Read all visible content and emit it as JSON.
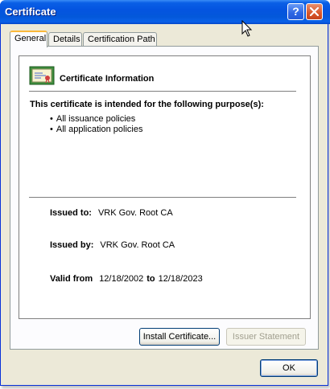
{
  "window": {
    "title": "Certificate",
    "help_label": "?"
  },
  "tabs": [
    {
      "label": "General",
      "active": true
    },
    {
      "label": "Details",
      "active": false
    },
    {
      "label": "Certification Path",
      "active": false
    }
  ],
  "general": {
    "info_title": "Certificate Information",
    "purpose_heading": "This certificate is intended for the following purpose(s):",
    "purposes": [
      "All issuance policies",
      "All application policies"
    ],
    "issued_to_label": "Issued to:",
    "issued_to_value": "VRK Gov. Root CA",
    "issued_by_label": "Issued by:",
    "issued_by_value": "VRK Gov. Root CA",
    "valid_from_label": "Valid from",
    "valid_from_value": "12/18/2002",
    "valid_to_label": "to",
    "valid_to_value": "12/18/2023"
  },
  "buttons": {
    "install_certificate": "Install Certificate...",
    "issuer_statement": "Issuer Statement",
    "ok": "OK"
  },
  "icons": {
    "certificate": "certificate-icon",
    "help": "help-icon",
    "close": "close-icon",
    "cursor": "mouse-cursor-icon"
  }
}
